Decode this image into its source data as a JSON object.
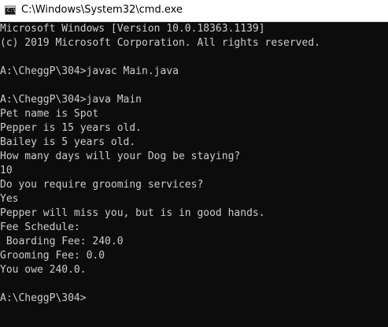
{
  "window": {
    "title": "C:\\Windows\\System32\\cmd.exe",
    "icon": "cmd-icon"
  },
  "console": {
    "lines": [
      "Microsoft Windows [Version 10.0.18363.1139]",
      "(c) 2019 Microsoft Corporation. All rights reserved.",
      "",
      "A:\\CheggP\\304>javac Main.java",
      "",
      "A:\\CheggP\\304>java Main",
      "Pet name is Spot",
      "Pepper is 15 years old.",
      "Bailey is 5 years old.",
      "How many days will your Dog be staying?",
      "10",
      "Do you require grooming services?",
      "Yes",
      "Pepper will miss you, but is in good hands.",
      "Fee Schedule:",
      " Boarding Fee: 240.0",
      "Grooming Fee: 0.0",
      "You owe 240.0.",
      "",
      "A:\\CheggP\\304>"
    ]
  }
}
